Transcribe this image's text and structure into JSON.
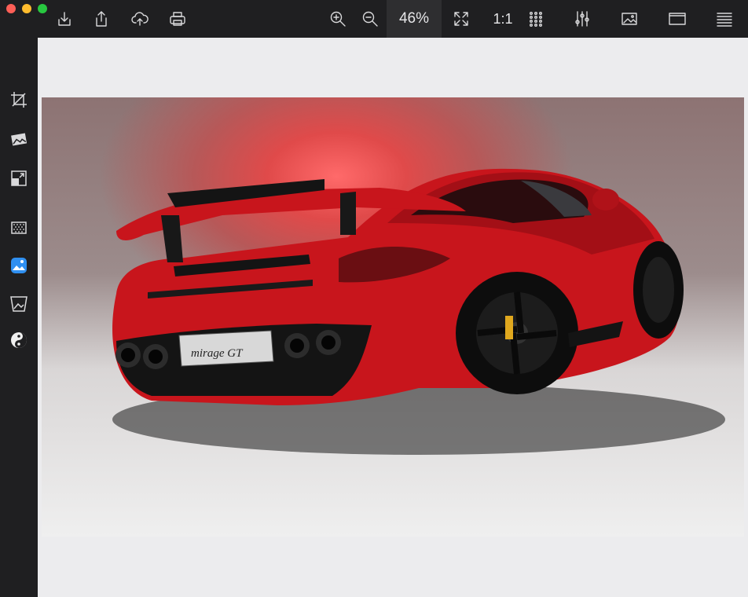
{
  "window": {
    "controls": [
      "close",
      "minimize",
      "zoom"
    ],
    "colors": {
      "close": "#fe5f57",
      "minimize": "#febc2e",
      "zoom": "#28c840"
    }
  },
  "toolbar": {
    "left_icons": [
      "download-icon",
      "share-icon",
      "cloud-upload-icon",
      "print-icon"
    ],
    "zoom_in_icon": "zoom-in-icon",
    "zoom_out_icon": "zoom-out-icon",
    "zoom_level": "46%",
    "fit_icon": "fit-to-window-icon",
    "actual_size_label": "1:1",
    "right_icons": [
      "grid-view-icon",
      "adjustments-icon",
      "image-icon",
      "window-icon",
      "menu-icon"
    ]
  },
  "sidebar": {
    "tools": [
      "crop-icon",
      "rotate-image-icon",
      "resize-icon",
      "noise-icon",
      "enhance-icon",
      "perspective-icon",
      "invert-icon"
    ]
  },
  "image": {
    "subject": "red sports car, rear three-quarter view",
    "plate_text": "mirage GT",
    "emblem_text": "mirage GT"
  },
  "colors": {
    "toolbar_bg": "#1f1f21",
    "canvas_bg": "#ececee",
    "car_red": "#c8151c"
  }
}
